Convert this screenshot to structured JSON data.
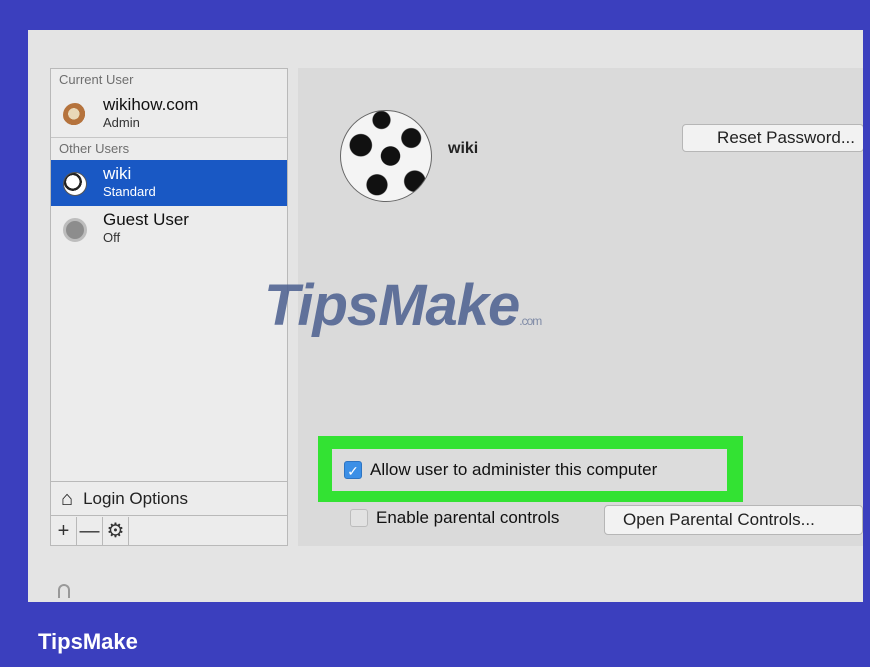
{
  "sidebar": {
    "current_user_label": "Current User",
    "current_user": {
      "name": "wikihow.com",
      "role": "Admin",
      "avatar_icon": "admin-avatar-icon"
    },
    "other_users_label": "Other Users",
    "other_users": [
      {
        "name": "wiki",
        "role": "Standard",
        "selected": true,
        "avatar_icon": "soccer-ball-icon"
      },
      {
        "name": "Guest User",
        "role": "Off",
        "selected": false,
        "avatar_icon": "guest-user-icon"
      }
    ],
    "login_options_label": "Login Options",
    "bottom_buttons": [
      "+",
      "—",
      "⚙"
    ]
  },
  "main": {
    "username": "wiki",
    "reset_password_label": "Reset Password...",
    "allow_admin": {
      "label": "Allow user to administer this computer",
      "checked": true
    },
    "parental_controls": {
      "label": "Enable parental controls",
      "checked": false
    },
    "open_parental_controls_label": "Open Parental Controls..."
  },
  "watermark": {
    "text": "TipsMake",
    "suffix": ".com"
  },
  "footer": {
    "brand": "TipsMake"
  },
  "colors": {
    "background": "#3b3fbe",
    "selection": "#1958c4",
    "highlight": "#33e233",
    "checkbox_on": "#3b8fe6"
  }
}
